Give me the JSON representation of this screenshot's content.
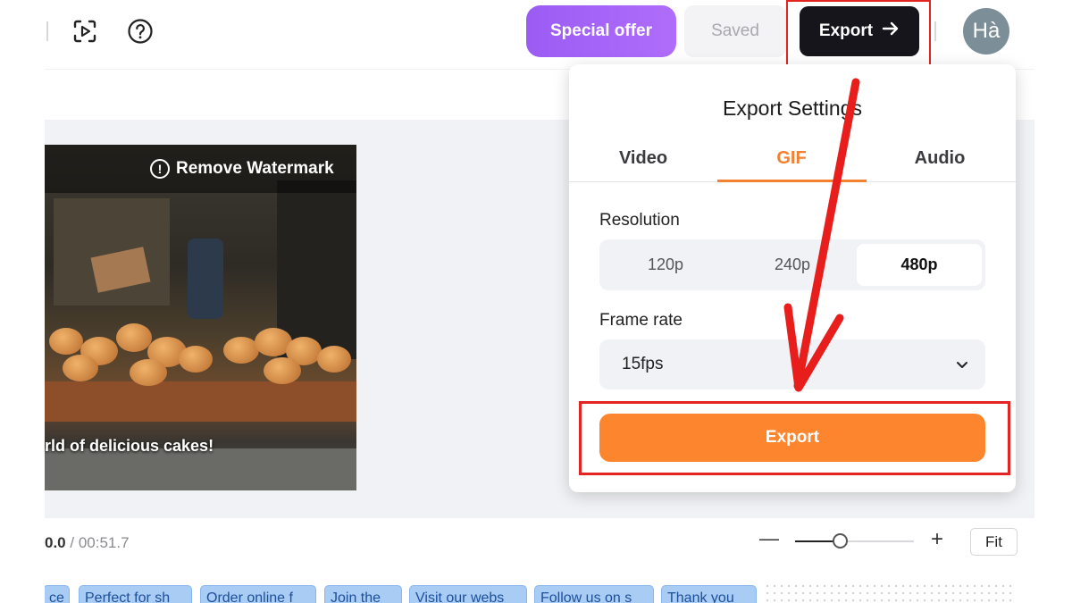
{
  "topbar": {
    "special_offer_label": "Special offer",
    "saved_label": "Saved",
    "export_label": "Export",
    "avatar_initials": "Hà"
  },
  "preview": {
    "watermark_label": "Remove Watermark",
    "caption": "rld of delicious cakes!"
  },
  "timeline": {
    "current_time": "0.0",
    "total_time": "00:51.7",
    "zoom_level": 0.38,
    "fit_label": "Fit",
    "clips": [
      "ce",
      "Perfect for sh",
      "Order online f",
      "Join the",
      "Visit our webs",
      "Follow us on s",
      "Thank you"
    ]
  },
  "export_panel": {
    "title": "Export Settings",
    "tabs": [
      "Video",
      "GIF",
      "Audio"
    ],
    "active_tab": "GIF",
    "resolution_label": "Resolution",
    "resolution_options": [
      "120p",
      "240p",
      "480p"
    ],
    "resolution_selected": "480p",
    "frame_rate_label": "Frame rate",
    "frame_rate_value": "15fps",
    "export_button": "Export"
  },
  "colors": {
    "accent_orange": "#fd852d",
    "highlight_red": "#e32421",
    "offer_purple": "#9b5cf4"
  }
}
